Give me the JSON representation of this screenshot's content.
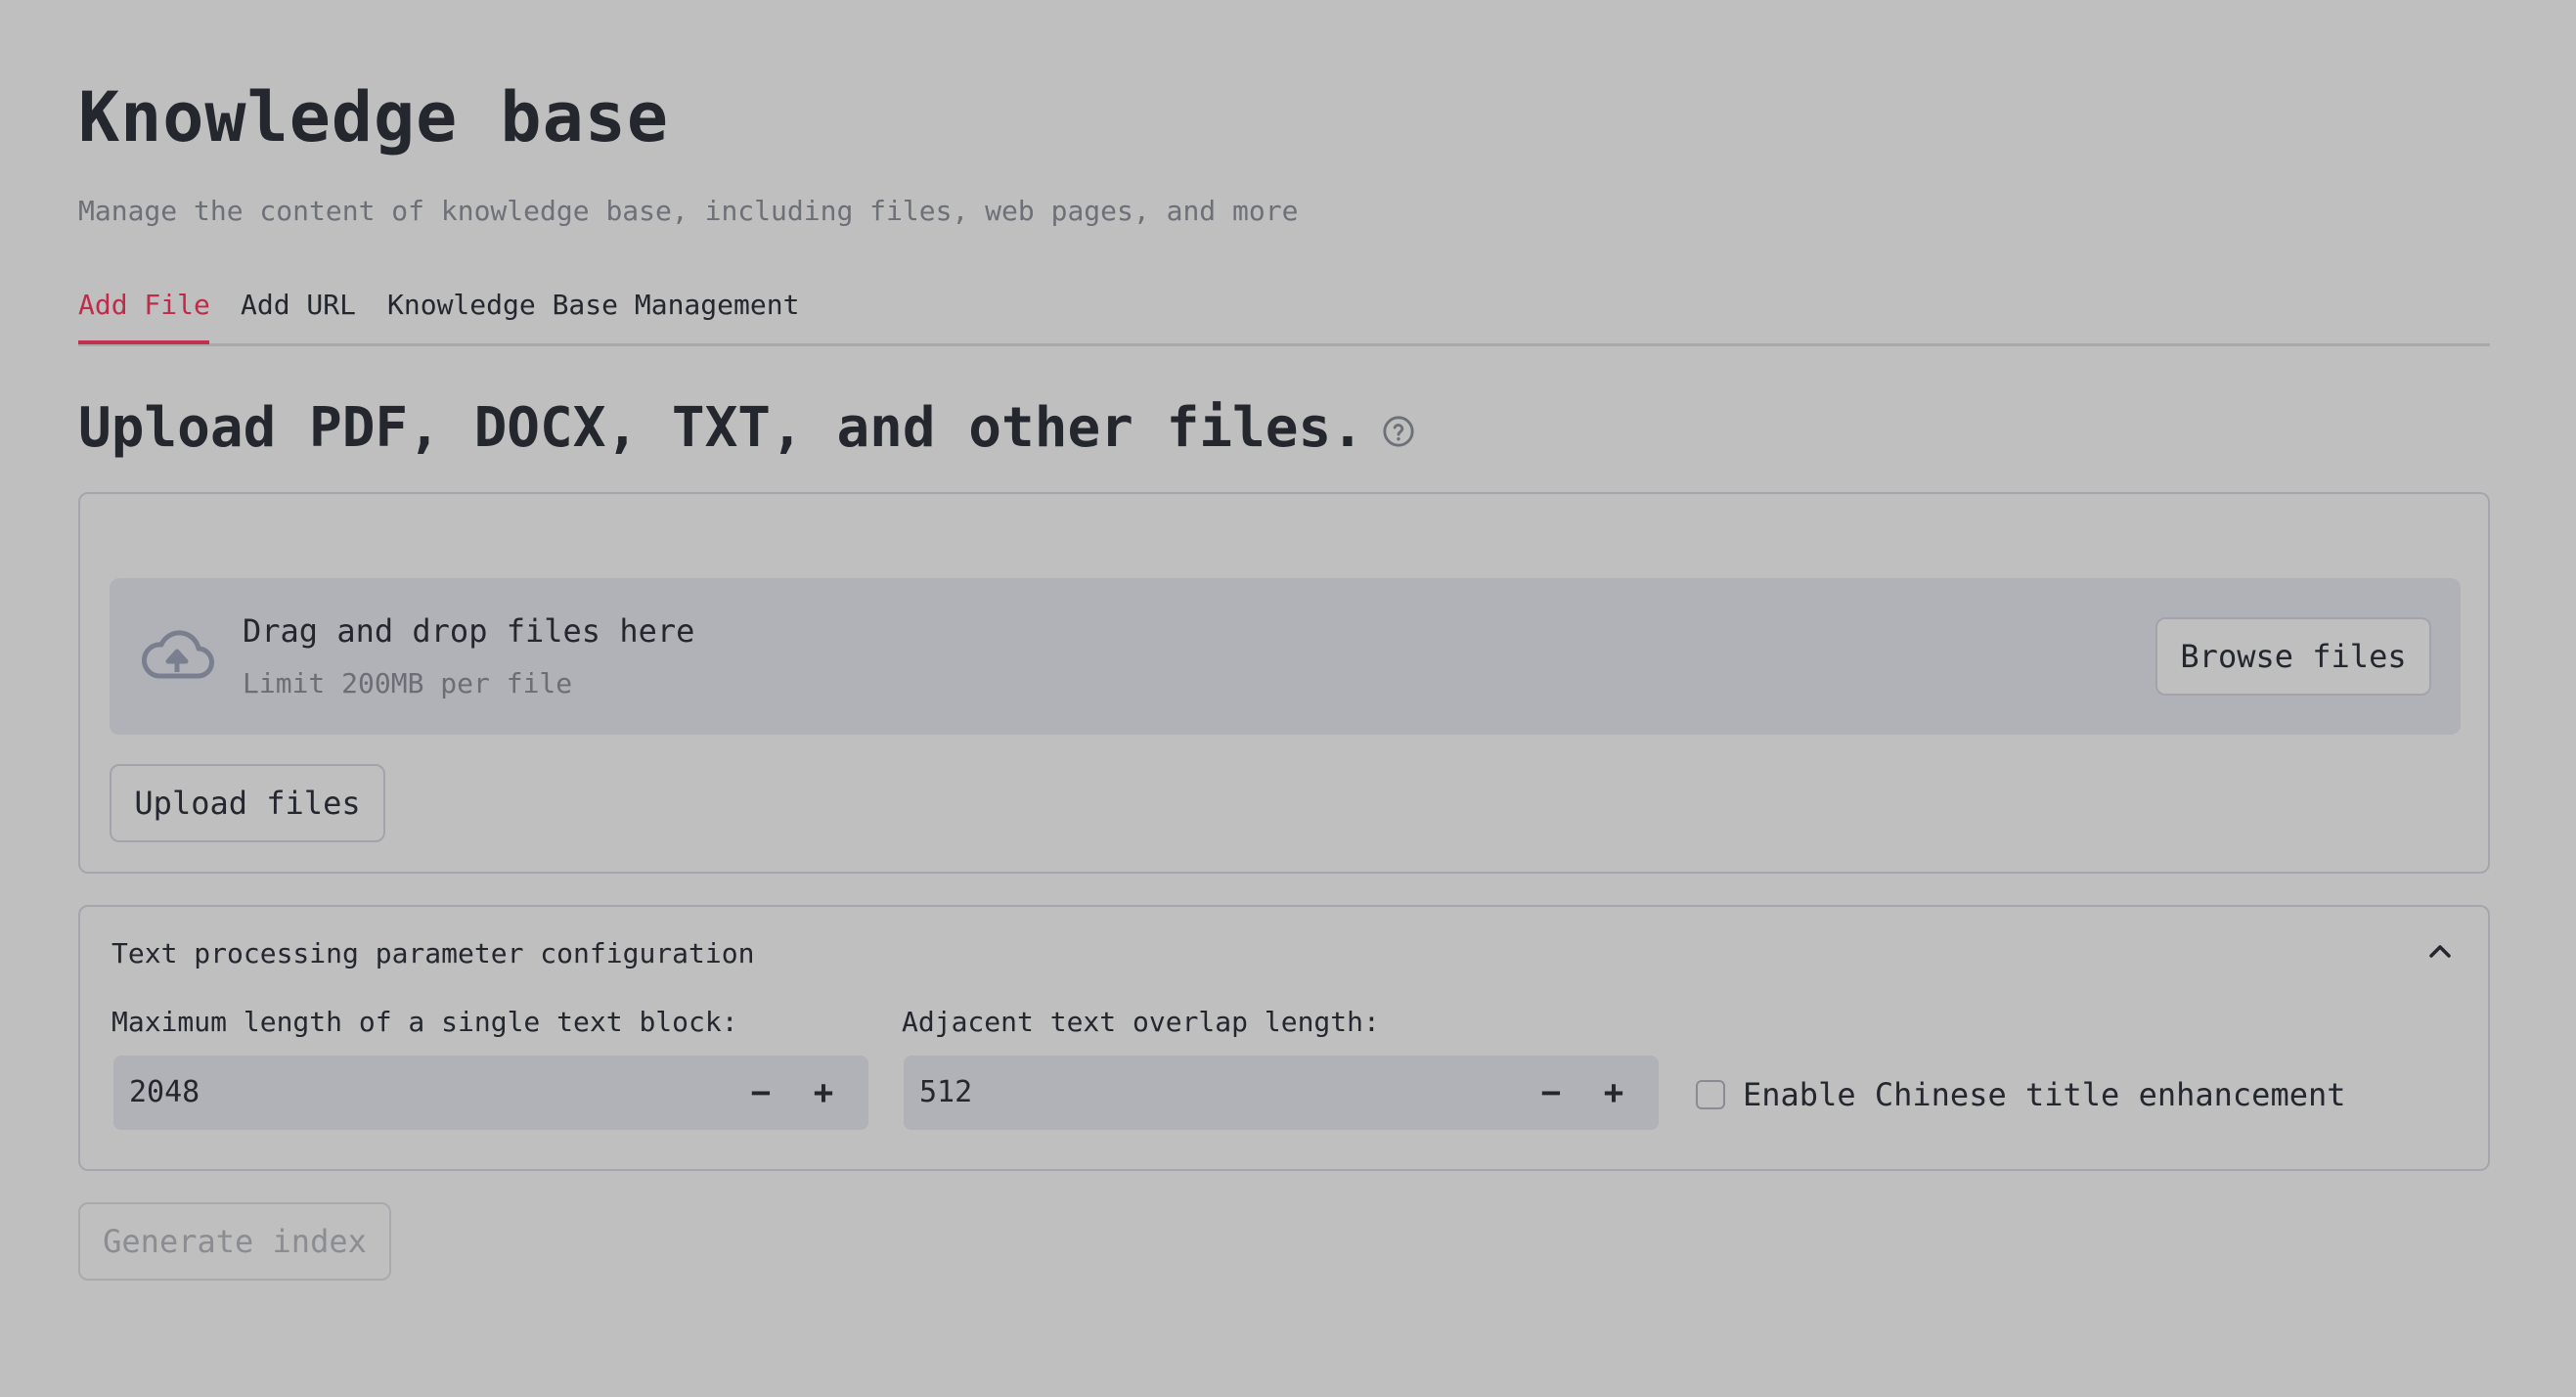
{
  "header": {
    "title": "Knowledge base",
    "subtitle": "Manage the content of knowledge base, including files, web pages, and more"
  },
  "tabs": [
    {
      "label": "Add File",
      "active": true
    },
    {
      "label": "Add URL",
      "active": false
    },
    {
      "label": "Knowledge Base Management",
      "active": false
    }
  ],
  "upload": {
    "section_title": "Upload PDF, DOCX, TXT, and other files.",
    "help_icon": "question-circle-icon",
    "dropzone_title": "Drag and drop files here",
    "dropzone_limit": "Limit 200MB per file",
    "browse_label": "Browse files",
    "upload_label": "Upload files"
  },
  "config": {
    "title": "Text processing parameter configuration",
    "expanded": true,
    "max_length_label": "Maximum length of a single text block:",
    "max_length_value": "2048",
    "overlap_label": "Adjacent text overlap length:",
    "overlap_value": "512",
    "minus_symbol": "−",
    "plus_symbol": "+",
    "chinese_title_label": "Enable Chinese title enhancement",
    "chinese_title_checked": false
  },
  "actions": {
    "generate_label": "Generate index",
    "generate_disabled": true
  },
  "colors": {
    "background": "#bfbfbf",
    "accent": "#c3304e",
    "text": "#25272f",
    "muted": "#6e7078"
  }
}
